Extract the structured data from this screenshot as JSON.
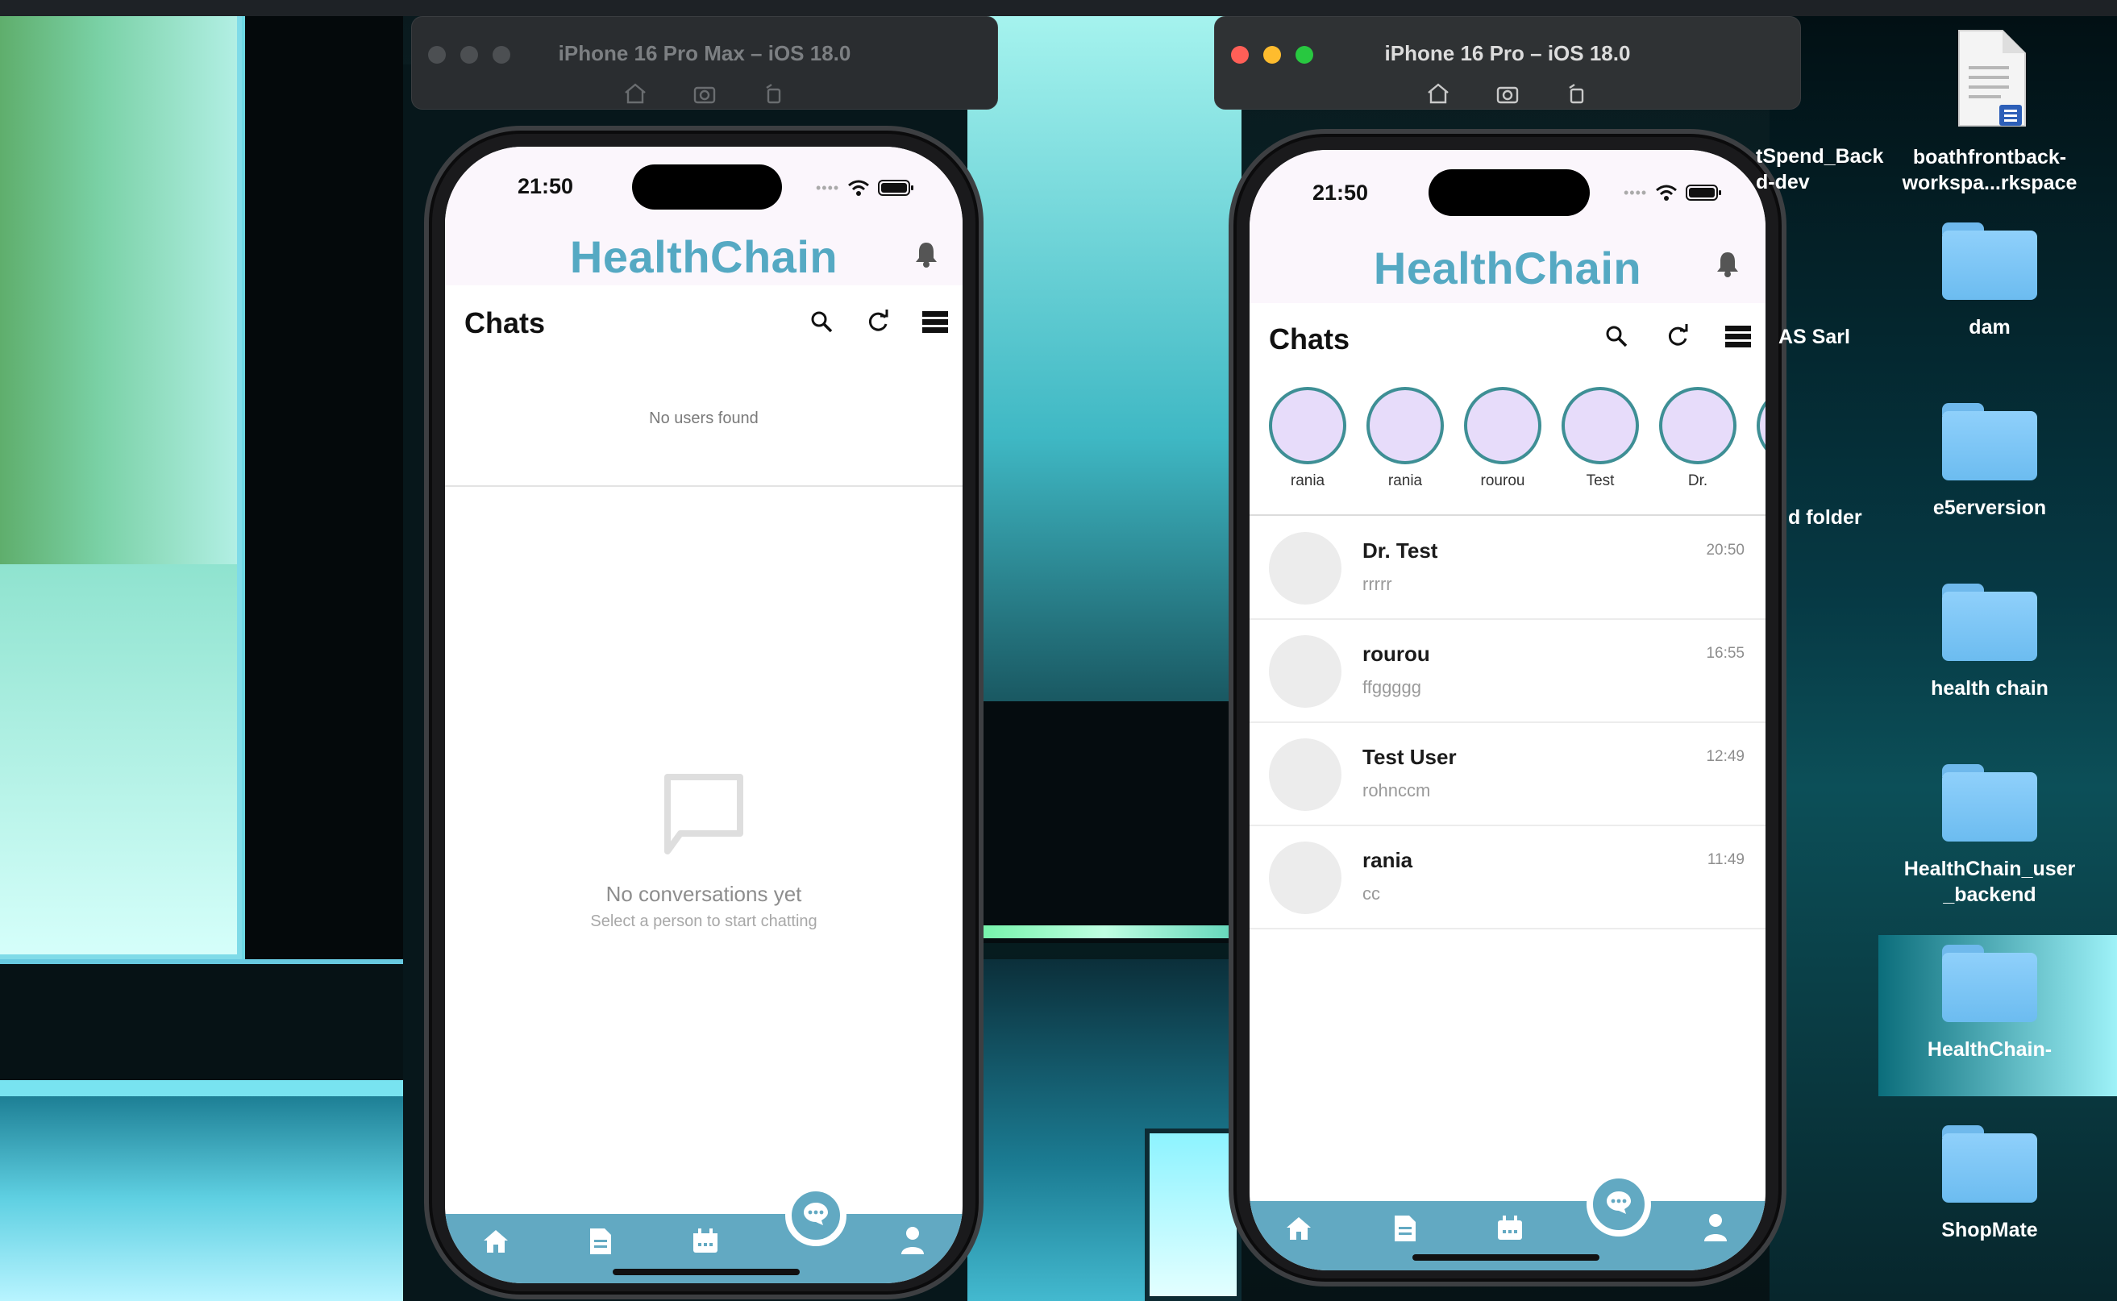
{
  "simulators": [
    {
      "title": "iPhone 16 Pro Max – iOS 18.0",
      "active": false,
      "status_time": "21:50",
      "app_title": "HealthChain",
      "chats_title": "Chats",
      "no_users_text": "No users found",
      "empty_title": "No conversations yet",
      "empty_subtitle": "Select a person to start chatting"
    },
    {
      "title": "iPhone 16 Pro – iOS 18.0",
      "active": true,
      "status_time": "21:50",
      "app_title": "HealthChain",
      "chats_title": "Chats",
      "stories": [
        "rania",
        "rania",
        "rourou",
        "Test",
        "Dr."
      ],
      "conversations": [
        {
          "name": "Dr. Test",
          "last_message": "rrrrr",
          "time": "20:50"
        },
        {
          "name": "rourou",
          "last_message": "ffggggg",
          "time": "16:55"
        },
        {
          "name": "Test User",
          "last_message": "rohnccm",
          "time": "12:49"
        },
        {
          "name": "rania",
          "last_message": "cc",
          "time": "11:49"
        }
      ]
    }
  ],
  "nav_icons": [
    "home-icon",
    "document-icon",
    "calendar-icon",
    "chat-icon",
    "person-icon"
  ],
  "desktop_icons": [
    {
      "label": "boathfrontback-\nworkspa...rkspace",
      "type": "document"
    },
    {
      "label": "dam",
      "type": "folder"
    },
    {
      "label": "e5erversion",
      "type": "folder"
    },
    {
      "label": "health chain",
      "type": "folder"
    },
    {
      "label": "HealthChain_user\n_backend",
      "type": "folder"
    },
    {
      "label": "HealthChain-",
      "type": "folder"
    },
    {
      "label": "ShopMate",
      "type": "folder"
    }
  ],
  "partial_labels": {
    "spend_back": "tSpend_Back\nd-dev",
    "sarl": "AS Sarl",
    "folder": "d folder"
  },
  "colors": {
    "brand": "#55a9c3",
    "nav": "#62a9c2",
    "story_ring": "#3e8f95",
    "story_fill": "#e7dcfa",
    "folder": "#8fd0fb"
  }
}
